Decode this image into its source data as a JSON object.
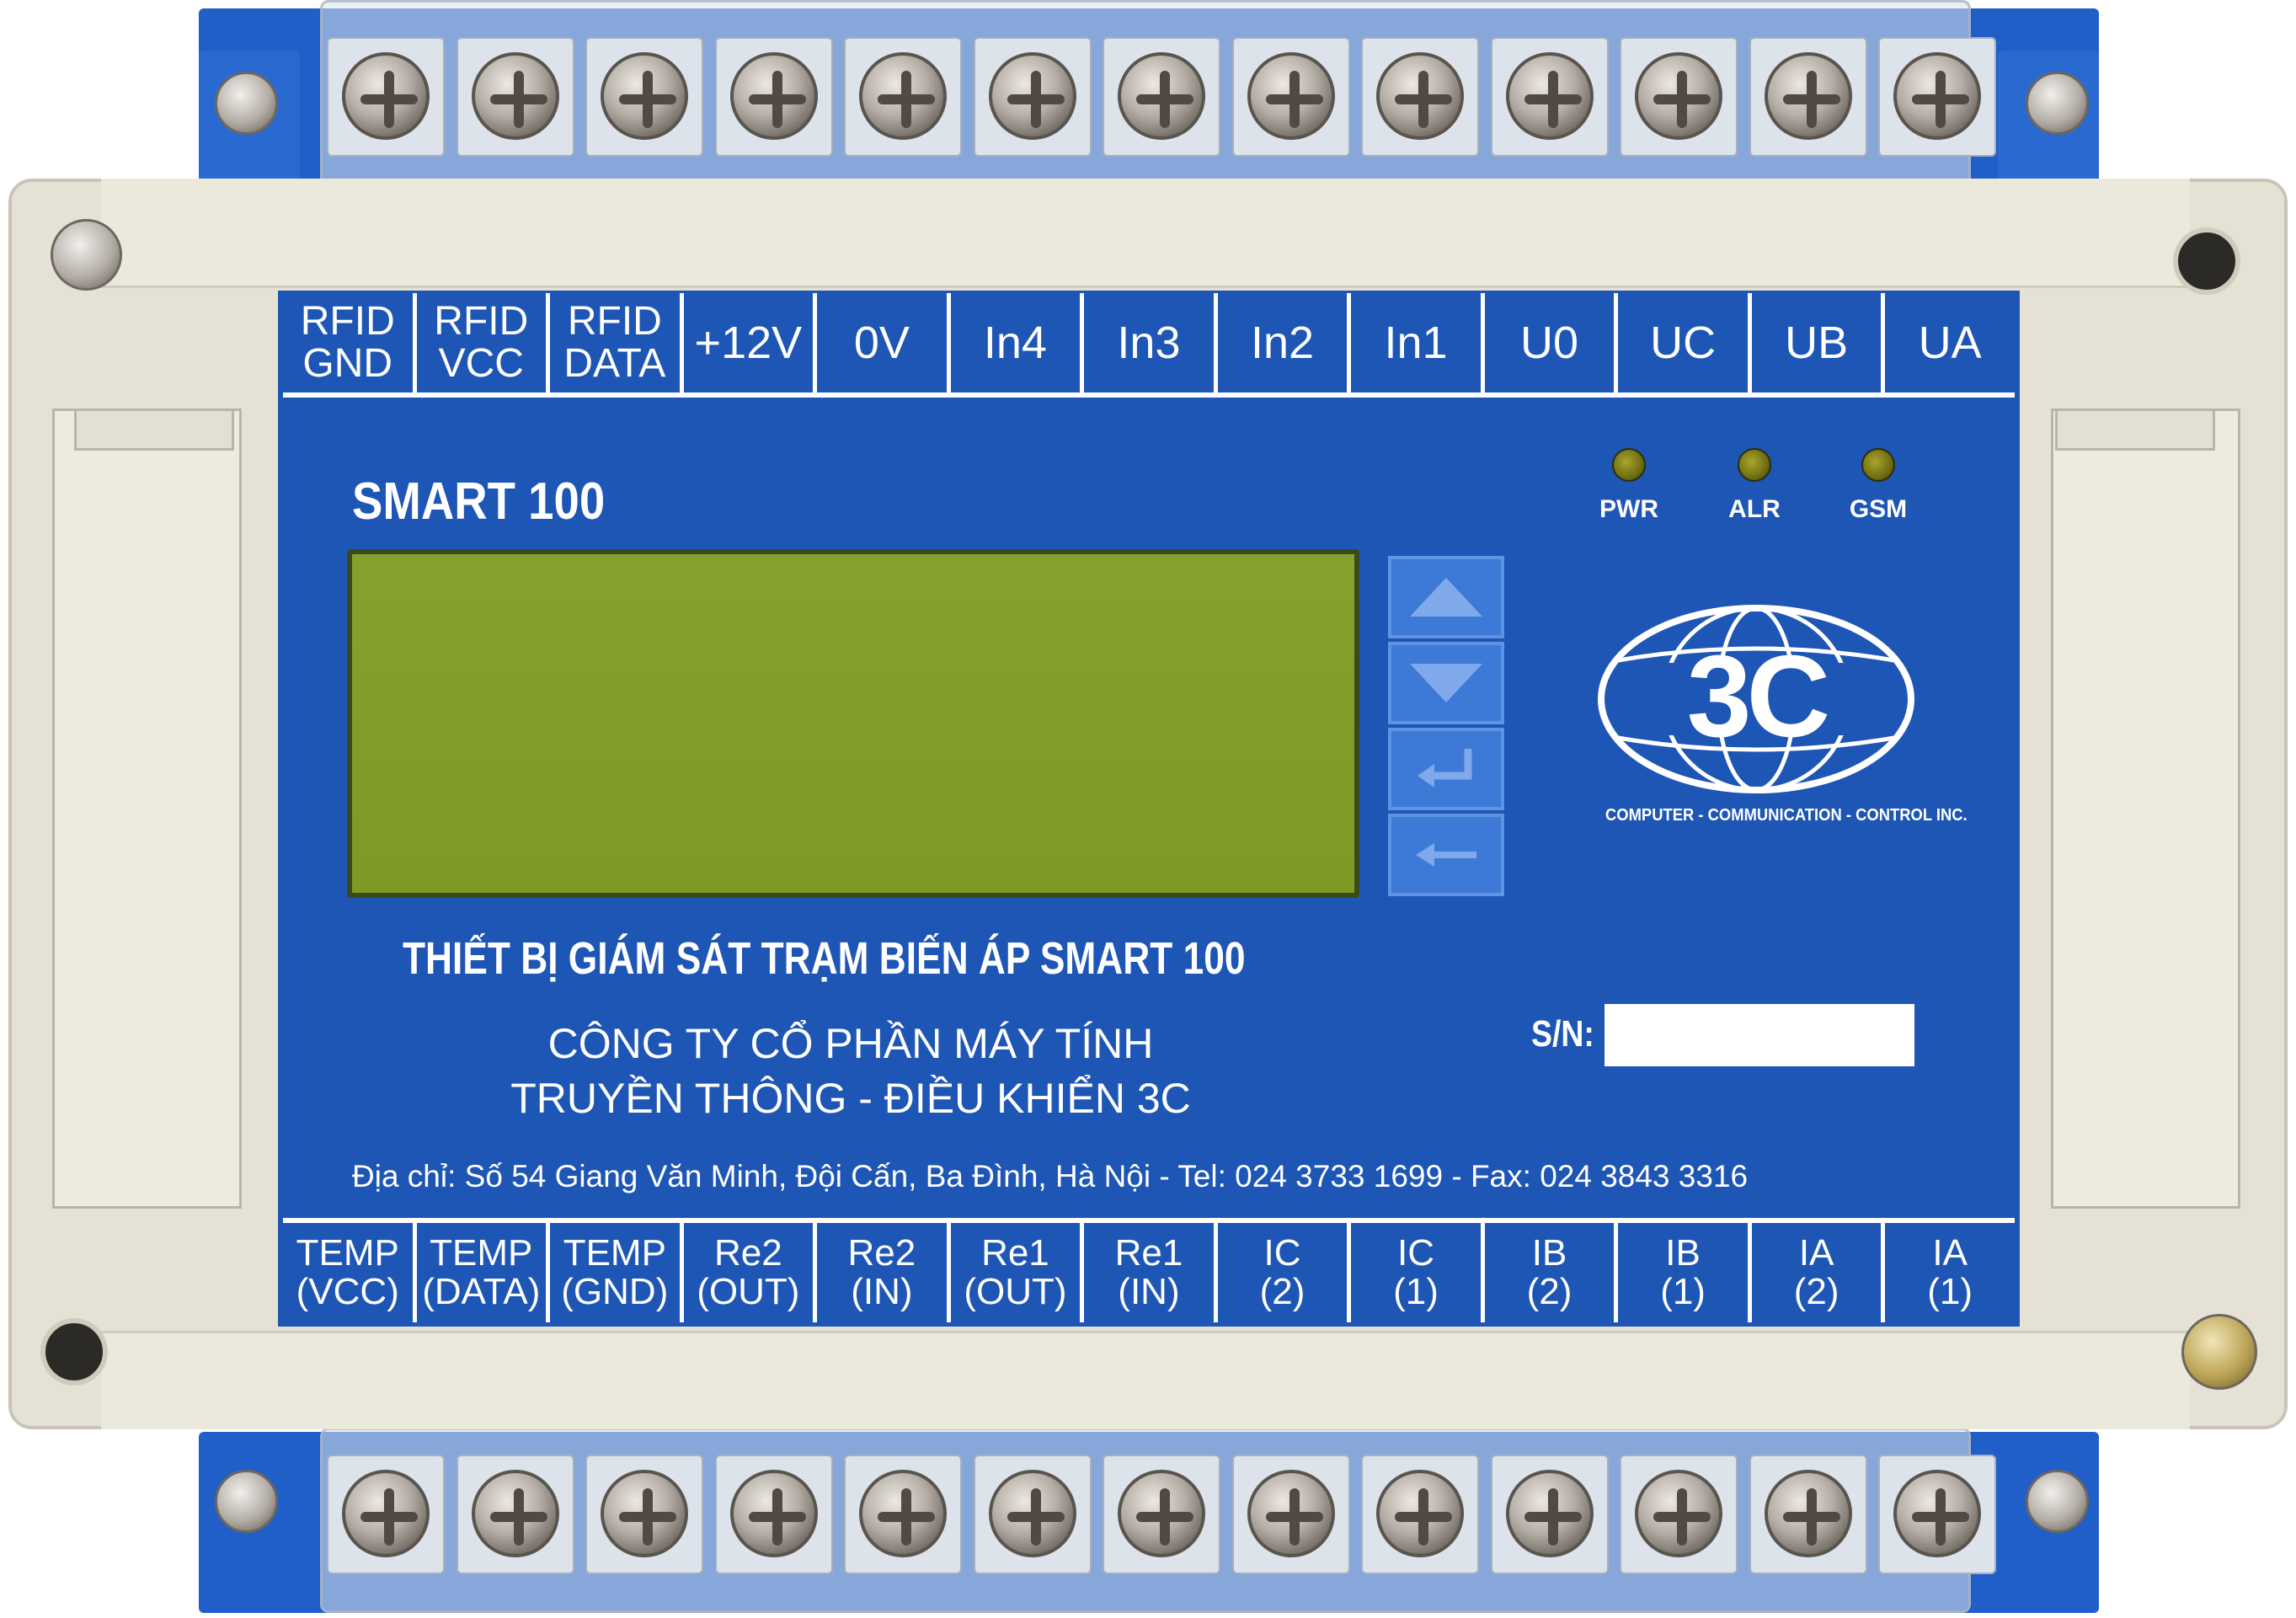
{
  "device": {
    "model": "SMART 100",
    "title_line": "THIẾT BỊ GIÁM SÁT TRẠM BIẾN ÁP SMART 100",
    "company_line1": "CÔNG TY CỔ PHẦN MÁY TÍNH",
    "company_line2": "TRUYỀN THÔNG - ĐIỀU KHIỂN 3C",
    "address": "Địa chỉ: Số 54 Giang Văn Minh, Đội Cấn, Ba Đình, Hà Nội - Tel: 024 3733 1699 - Fax: 024 3843 3316",
    "serial_label": "S/N:",
    "serial_value": ""
  },
  "logo": {
    "mark": "3C",
    "tagline": "COMPUTER - COMMUNICATION - CONTROL INC."
  },
  "leds": [
    {
      "label": "PWR"
    },
    {
      "label": "ALR"
    },
    {
      "label": "GSM"
    }
  ],
  "keys": [
    {
      "icon": "up-arrow-icon"
    },
    {
      "icon": "down-arrow-icon"
    },
    {
      "icon": "enter-icon"
    },
    {
      "icon": "back-arrow-icon"
    }
  ],
  "top_terminals": [
    {
      "line1": "RFID",
      "line2": "GND"
    },
    {
      "line1": "RFID",
      "line2": "VCC"
    },
    {
      "line1": "RFID",
      "line2": "DATA"
    },
    {
      "line1": "+12V",
      "line2": ""
    },
    {
      "line1": "0V",
      "line2": ""
    },
    {
      "line1": "In4",
      "line2": ""
    },
    {
      "line1": "In3",
      "line2": ""
    },
    {
      "line1": "In2",
      "line2": ""
    },
    {
      "line1": "In1",
      "line2": ""
    },
    {
      "line1": "U0",
      "line2": ""
    },
    {
      "line1": "UC",
      "line2": ""
    },
    {
      "line1": "UB",
      "line2": ""
    },
    {
      "line1": "UA",
      "line2": ""
    }
  ],
  "bottom_terminals": [
    {
      "line1": "TEMP",
      "line2": "(VCC)"
    },
    {
      "line1": "TEMP",
      "line2": "(DATA)"
    },
    {
      "line1": "TEMP",
      "line2": "(GND)"
    },
    {
      "line1": "Re2",
      "line2": "(OUT)"
    },
    {
      "line1": "Re2",
      "line2": "(IN)"
    },
    {
      "line1": "Re1",
      "line2": "(OUT)"
    },
    {
      "line1": "Re1",
      "line2": "(IN)"
    },
    {
      "line1": "IC",
      "line2": "(2)"
    },
    {
      "line1": "IC",
      "line2": "(1)"
    },
    {
      "line1": "IB",
      "line2": "(2)"
    },
    {
      "line1": "IB",
      "line2": "(1)"
    },
    {
      "line1": "IA",
      "line2": "(2)"
    },
    {
      "line1": "IA",
      "line2": "(1)"
    }
  ],
  "colors": {
    "panel_blue": "#1e56b6",
    "housing_beige": "#e5e2d5",
    "lcd_green": "#7d9a24"
  }
}
